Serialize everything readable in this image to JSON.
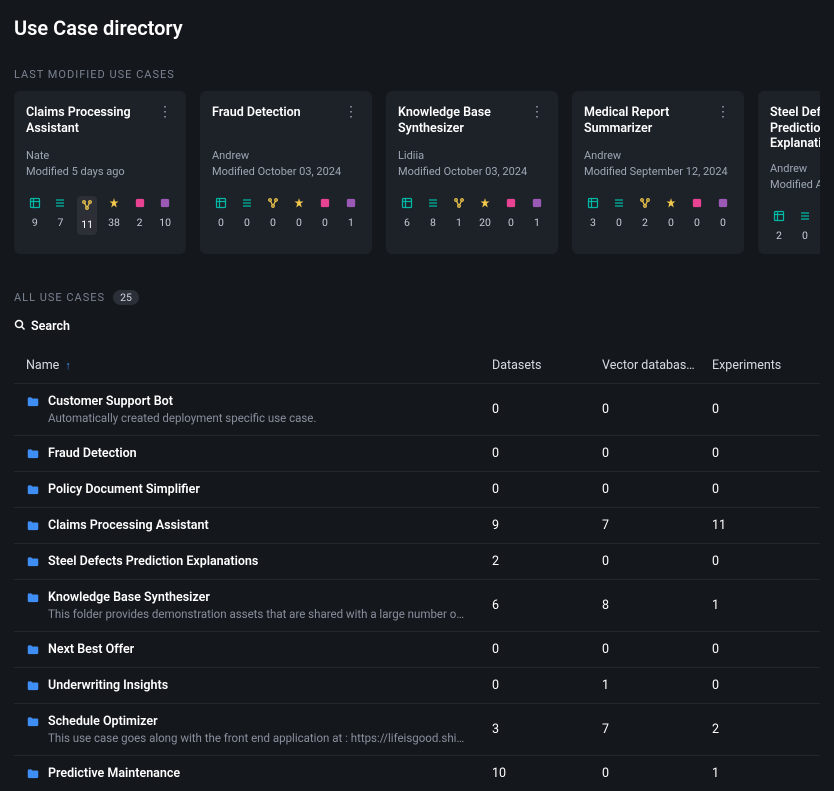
{
  "page_title": "Use Case directory",
  "last_modified_label": "LAST MODIFIED USE CASES",
  "all_label": "ALL USE CASES",
  "all_count": "25",
  "search_label": "Search",
  "columns": {
    "name": "Name",
    "datasets": "Datasets",
    "vector": "Vector databas…",
    "experiments": "Experiments"
  },
  "cards": [
    {
      "title": "Claims Processing Assistant",
      "author": "Nate",
      "modified": "Modified 5 days ago",
      "stats": [
        "9",
        "7",
        "11",
        "38",
        "2",
        "10"
      ],
      "hil": 2
    },
    {
      "title": "Fraud Detection",
      "author": "Andrew",
      "modified": "Modified October 03, 2024",
      "stats": [
        "0",
        "0",
        "0",
        "0",
        "0",
        "1"
      ],
      "hil": -1
    },
    {
      "title": "Knowledge Base Synthesizer",
      "author": "Lidiia",
      "modified": "Modified October 03, 2024",
      "stats": [
        "6",
        "8",
        "1",
        "20",
        "0",
        "1"
      ],
      "hil": -1
    },
    {
      "title": "Medical Report Summarizer",
      "author": "Andrew",
      "modified": "Modified September 12, 2024",
      "stats": [
        "3",
        "0",
        "2",
        "0",
        "0",
        "0"
      ],
      "hil": -1
    },
    {
      "title": "Steel Defects Prediction Explanations",
      "author": "Andrew",
      "modified": "Modified Au",
      "stats": [
        "2",
        "0"
      ],
      "hil": -1
    }
  ],
  "rows": [
    {
      "name": "Customer Support Bot",
      "desc": "Automatically created deployment specific use case.",
      "datasets": "0",
      "vector": "0",
      "experiments": "0"
    },
    {
      "name": "Fraud Detection",
      "desc": "",
      "datasets": "0",
      "vector": "0",
      "experiments": "0"
    },
    {
      "name": "Policy Document Simplifier",
      "desc": "",
      "datasets": "0",
      "vector": "0",
      "experiments": "0"
    },
    {
      "name": "Claims Processing Assistant",
      "desc": "",
      "datasets": "9",
      "vector": "7",
      "experiments": "11"
    },
    {
      "name": "Steel Defects Prediction Explanations",
      "desc": "",
      "datasets": "2",
      "vector": "0",
      "experiments": "0"
    },
    {
      "name": "Knowledge Base Synthesizer",
      "desc": "This folder provides demonstration assets that are shared with a large number of DataRobot st…",
      "datasets": "6",
      "vector": "8",
      "experiments": "1"
    },
    {
      "name": "Next Best Offer",
      "desc": "",
      "datasets": "0",
      "vector": "0",
      "experiments": "0"
    },
    {
      "name": "Underwriting Insights",
      "desc": "",
      "datasets": "0",
      "vector": "1",
      "experiments": "0"
    },
    {
      "name": "Schedule Optimizer",
      "desc": "This use case goes along with the front end application at : https://lifeisgood.shinyapps.io/Mo…",
      "datasets": "3",
      "vector": "7",
      "experiments": "2"
    },
    {
      "name": "Predictive Maintenance",
      "desc": "",
      "datasets": "10",
      "vector": "0",
      "experiments": "1"
    }
  ],
  "icon_colors": [
    "#00b8a3",
    "#00b8a3",
    "#f2c94c",
    "#f2c94c",
    "#e84393",
    "#9b59b6"
  ]
}
